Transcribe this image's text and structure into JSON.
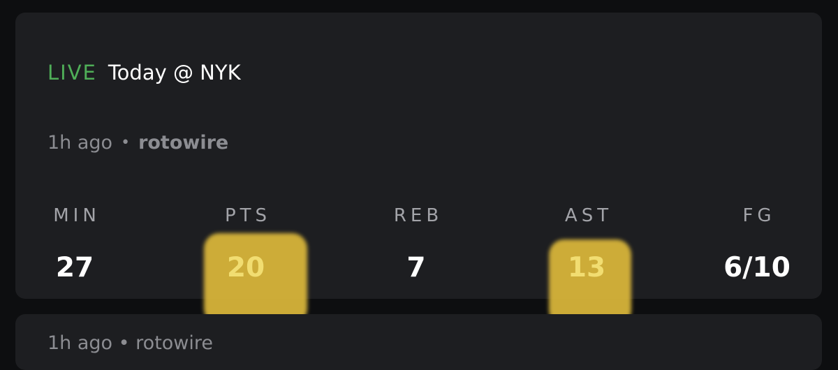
{
  "card": {
    "status": "LIVE",
    "matchup": "Today @ NYK",
    "time_ago": "1h ago",
    "separator": "•",
    "source": "rotowire",
    "stats": [
      {
        "label": "MIN",
        "value": "27",
        "highlighted": false
      },
      {
        "label": "PTS",
        "value": "20",
        "highlighted": true
      },
      {
        "label": "REB",
        "value": "7",
        "highlighted": false
      },
      {
        "label": "AST",
        "value": "13",
        "highlighted": true
      },
      {
        "label": "FG",
        "value": "6/10",
        "highlighted": false
      }
    ]
  },
  "next_card": {
    "partial_text": "1h ago • rotowire"
  },
  "colors": {
    "background": "#0d0e10",
    "card": "#1d1e21",
    "live": "#4fae58",
    "muted_text": "#8c8d92",
    "highlight": "#d7b43a",
    "highlight_text": "#f1dd71"
  }
}
